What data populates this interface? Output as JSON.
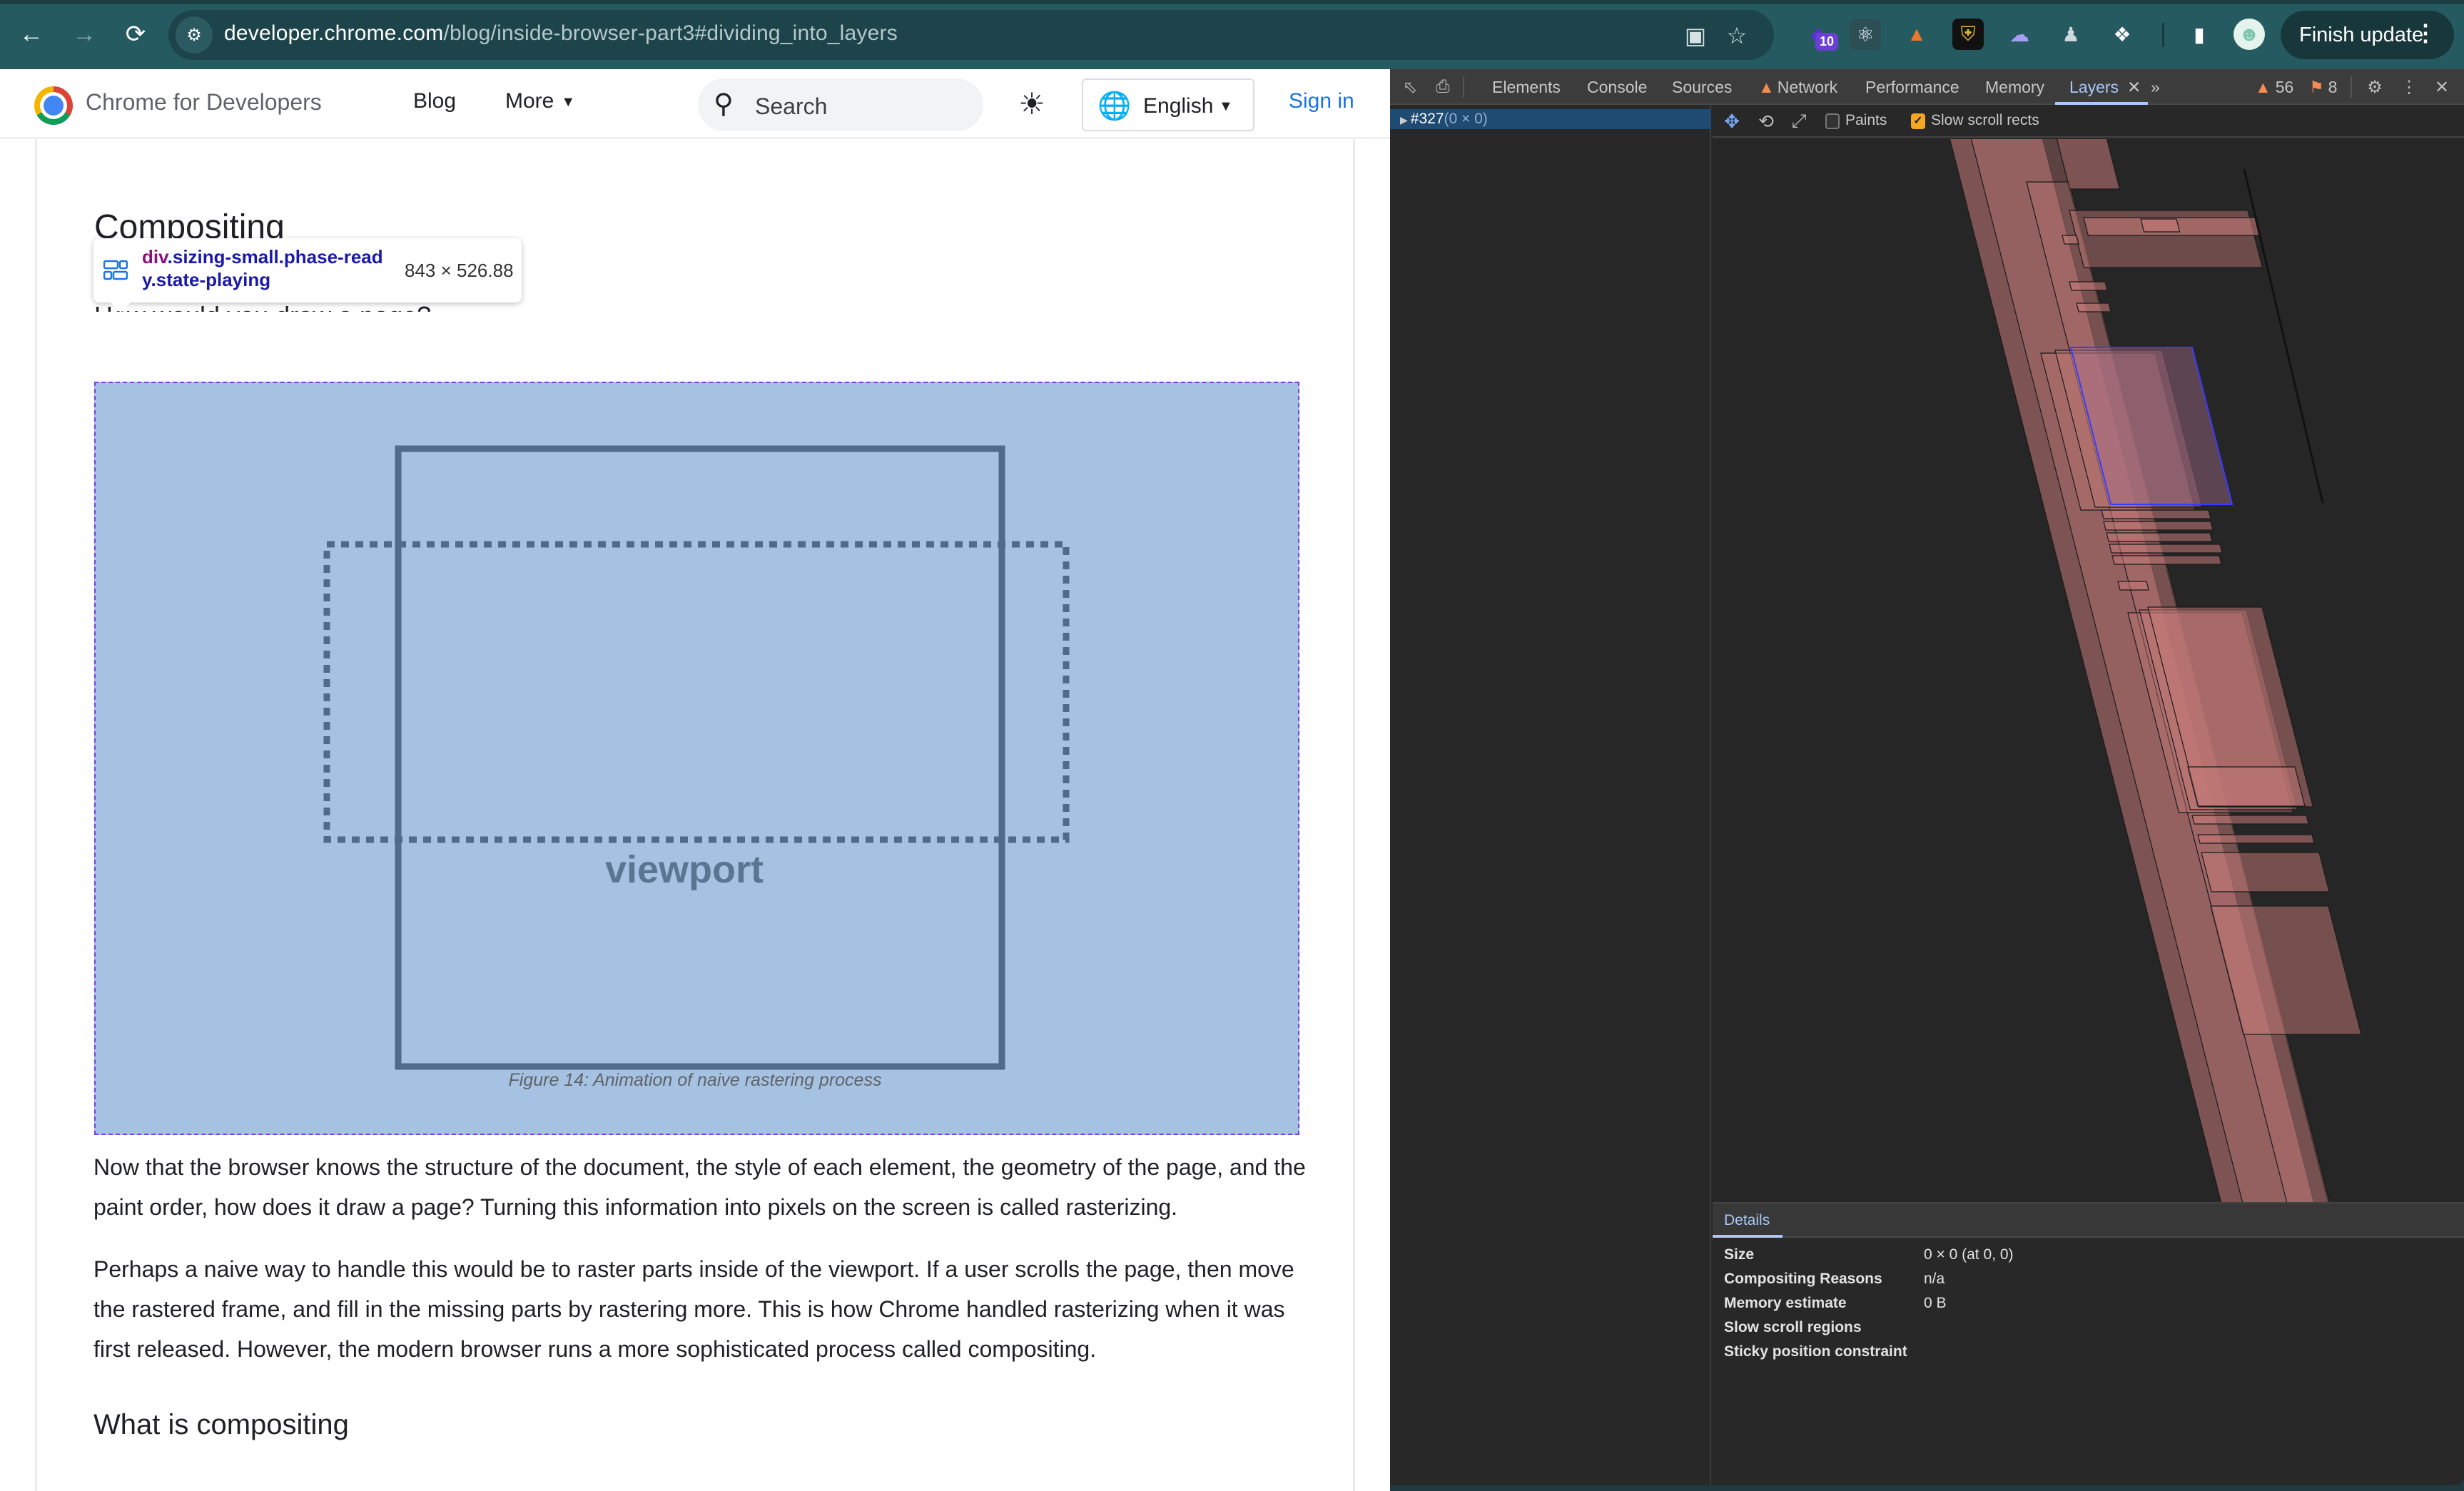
{
  "browser": {
    "url_host": "developer.chrome.com",
    "url_path": "/blog/inside-browser-part3#dividing_into_layers",
    "extension_badge": "10",
    "finish_update_label": "Finish update",
    "icons": {
      "back": "arrow-left-icon",
      "forward": "arrow-right-icon",
      "reload": "reload-icon",
      "site_info": "tune-icon",
      "install": "install-app-icon",
      "bookmark": "star-icon",
      "extensions": "puzzle-icon",
      "side_panel": "side-panel-icon",
      "profile": "avatar-icon",
      "menu": "kebab-menu-icon"
    }
  },
  "site": {
    "brand": "Chrome for Developers",
    "nav": {
      "blog": "Blog",
      "more": "More"
    },
    "search_placeholder": "Search",
    "language": "English",
    "sign_in": "Sign in"
  },
  "article": {
    "heading": "Compositing",
    "obscured_subheading": "How would you draw a page?",
    "tooltip": {
      "tag": "div",
      "classes": ".sizing-small.phase-ready.state-playing",
      "size": "843 × 526.88"
    },
    "figure": {
      "label": "viewport",
      "caption": "Figure 14: Animation of naive rastering process"
    },
    "paragraphs": [
      "Now that the browser knows the structure of the document, the style of each element, the geometry of the page, and the paint order, how does it draw a page? Turning this information into pixels on the screen is called rasterizing.",
      "Perhaps a naive way to handle this would be to raster parts inside of the viewport. If a user scrolls the page, then move the rastered frame, and fill in the missing parts by rastering more. This is how Chrome handled rasterizing when it was first released. However, the modern browser runs a more sophisticated process called compositing."
    ],
    "subheading": "What is compositing"
  },
  "devtools": {
    "tabs": [
      {
        "label": "Elements",
        "active": false,
        "warning": false
      },
      {
        "label": "Console",
        "active": false,
        "warning": false
      },
      {
        "label": "Sources",
        "active": false,
        "warning": false
      },
      {
        "label": "Network",
        "active": false,
        "warning": true
      },
      {
        "label": "Performance",
        "active": false,
        "warning": false
      },
      {
        "label": "Memory",
        "active": false,
        "warning": false
      },
      {
        "label": "Layers",
        "active": true,
        "warning": false
      }
    ],
    "warnings_count": "56",
    "issues_count": "8",
    "layer_tree": {
      "selected_id": "#327",
      "selected_size": "(0 × 0)"
    },
    "view_toolbar": {
      "paints_label": "Paints",
      "paints_checked": false,
      "slow_scroll_label": "Slow scroll rects",
      "slow_scroll_checked": true
    },
    "details": {
      "tab": "Details",
      "rows": [
        {
          "key": "Size",
          "value": "0 × 0 (at 0, 0)"
        },
        {
          "key": "Compositing Reasons",
          "value": "n/a"
        },
        {
          "key": "Memory estimate",
          "value": "0 B"
        },
        {
          "key": "Slow scroll regions",
          "value": ""
        },
        {
          "key": "Sticky position constraint",
          "value": ""
        }
      ]
    },
    "colors": {
      "layer_fill": "#c47a78",
      "selected_layer_outline": "#3a3aff",
      "accent": "#a8c7fa",
      "warning": "#f28b54"
    }
  }
}
